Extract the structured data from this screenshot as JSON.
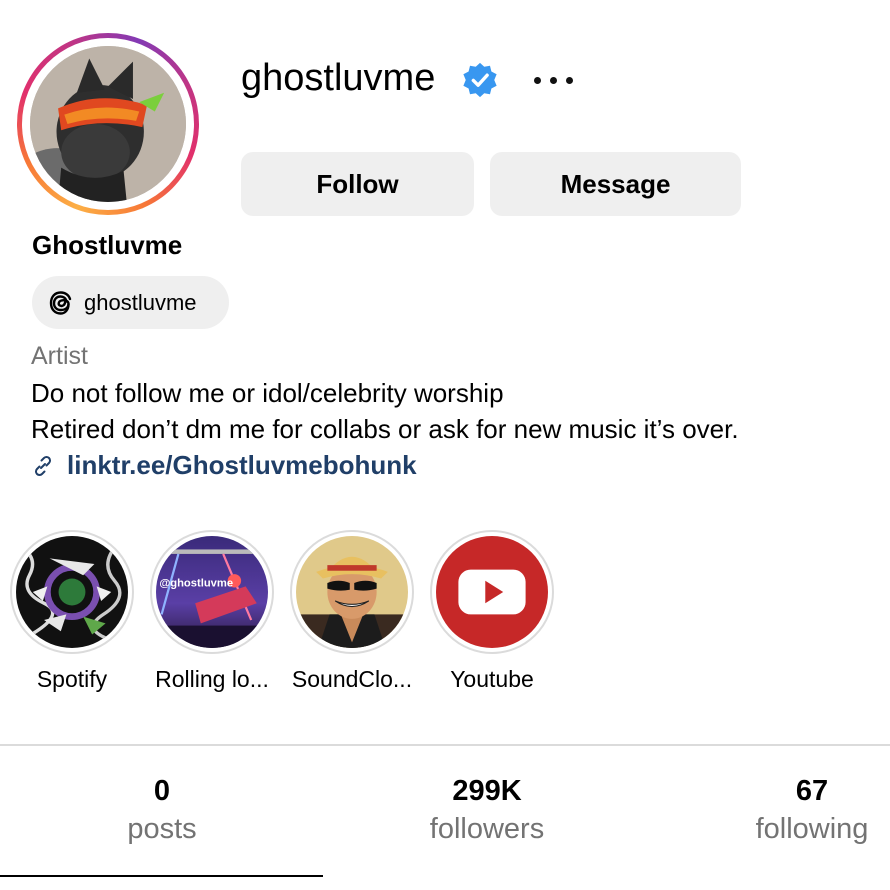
{
  "profile": {
    "username": "ghostluvme",
    "verified_icon": "verified-badge-icon",
    "more_icon": "more-options-icon",
    "display_name": "Ghostluvme",
    "threads_handle": "ghostluvme",
    "category": "Artist",
    "bio_lines": [
      "Do not follow me or idol/celebrity worship",
      "Retired don’t dm me for collabs or ask for new music it’s over."
    ],
    "link": "linktr.ee/Ghostluvmebohunk"
  },
  "actions": {
    "follow_label": "Follow",
    "message_label": "Message"
  },
  "highlights": [
    {
      "label": "Spotify"
    },
    {
      "label": "Rolling lo..."
    },
    {
      "label": "SoundClo..."
    },
    {
      "label": "Youtube"
    }
  ],
  "highlight_overlay_text": "@ghostluvme",
  "stats": {
    "posts": {
      "value": "0",
      "label": "posts"
    },
    "followers": {
      "value": "299K",
      "label": "followers"
    },
    "following": {
      "value": "67",
      "label": "following"
    }
  },
  "colors": {
    "link": "#203f68",
    "verified": "#3897f0",
    "button_bg": "#efefef",
    "muted_text": "#737373",
    "youtube_red": "#c62828"
  }
}
